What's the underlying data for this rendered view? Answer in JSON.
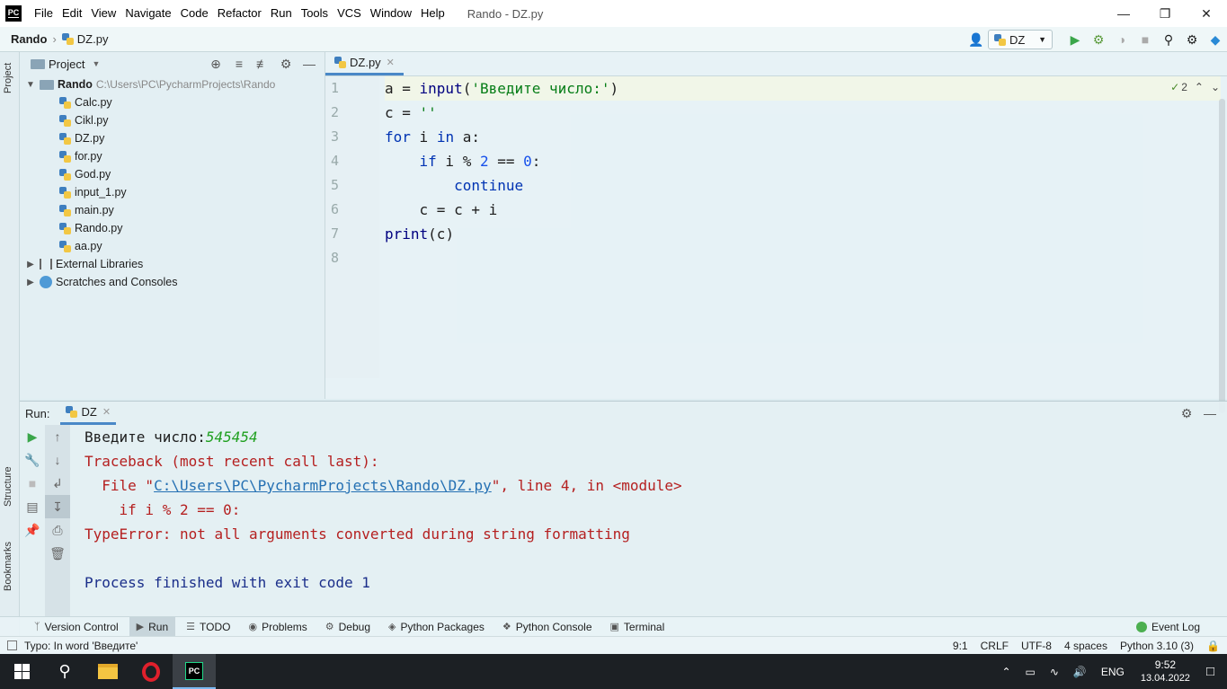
{
  "title_bar": {
    "logo": "PC",
    "menu": [
      "File",
      "Edit",
      "View",
      "Navigate",
      "Code",
      "Refactor",
      "Run",
      "Tools",
      "VCS",
      "Window",
      "Help"
    ],
    "window_title": "Rando - DZ.py"
  },
  "navbar": {
    "project": "Rando",
    "file": "DZ.py",
    "run_config": "DZ"
  },
  "left_stripe": {
    "project": "Project",
    "structure": "Structure",
    "bookmarks": "Bookmarks"
  },
  "project_panel": {
    "title": "Project",
    "root": {
      "name": "Rando",
      "path": "C:\\Users\\PC\\PycharmProjects\\Rando"
    },
    "files": [
      "Calc.py",
      "Cikl.py",
      "DZ.py",
      "for.py",
      "God.py",
      "input_1.py",
      "main.py",
      "Rando.py",
      "aa.py"
    ],
    "external_libraries": "External Libraries",
    "scratches": "Scratches and Consoles"
  },
  "editor": {
    "tab": "DZ.py",
    "inspection_count": "2",
    "line_numbers": [
      "1",
      "2",
      "3",
      "4",
      "5",
      "6",
      "7",
      "8"
    ]
  },
  "run_panel": {
    "label": "Run:",
    "tab": "DZ",
    "console": {
      "prompt": "Введите число:",
      "input": "545454",
      "traceback": "Traceback (most recent call last):",
      "file_prefix": "  File \"",
      "file_link": "C:\\Users\\PC\\PycharmProjects\\Rando\\DZ.py",
      "file_suffix": "\", line 4, in <module>",
      "code_line": "    if i % 2 == 0:",
      "error": "TypeError: not all arguments converted during string formatting",
      "finished": "Process finished with exit code 1"
    }
  },
  "bottom_tools": {
    "version_control": "Version Control",
    "run": "Run",
    "todo": "TODO",
    "problems": "Problems",
    "debug": "Debug",
    "python_packages": "Python Packages",
    "python_console": "Python Console",
    "terminal": "Terminal",
    "event_log": "Event Log"
  },
  "status_bar": {
    "message": "Typo: In word 'Введите'",
    "position": "9:1",
    "line_sep": "CRLF",
    "encoding": "UTF-8",
    "indent": "4 spaces",
    "interpreter": "Python 3.10 (3)"
  },
  "taskbar": {
    "lang": "ENG",
    "time": "9:52",
    "date": "13.04.2022"
  }
}
